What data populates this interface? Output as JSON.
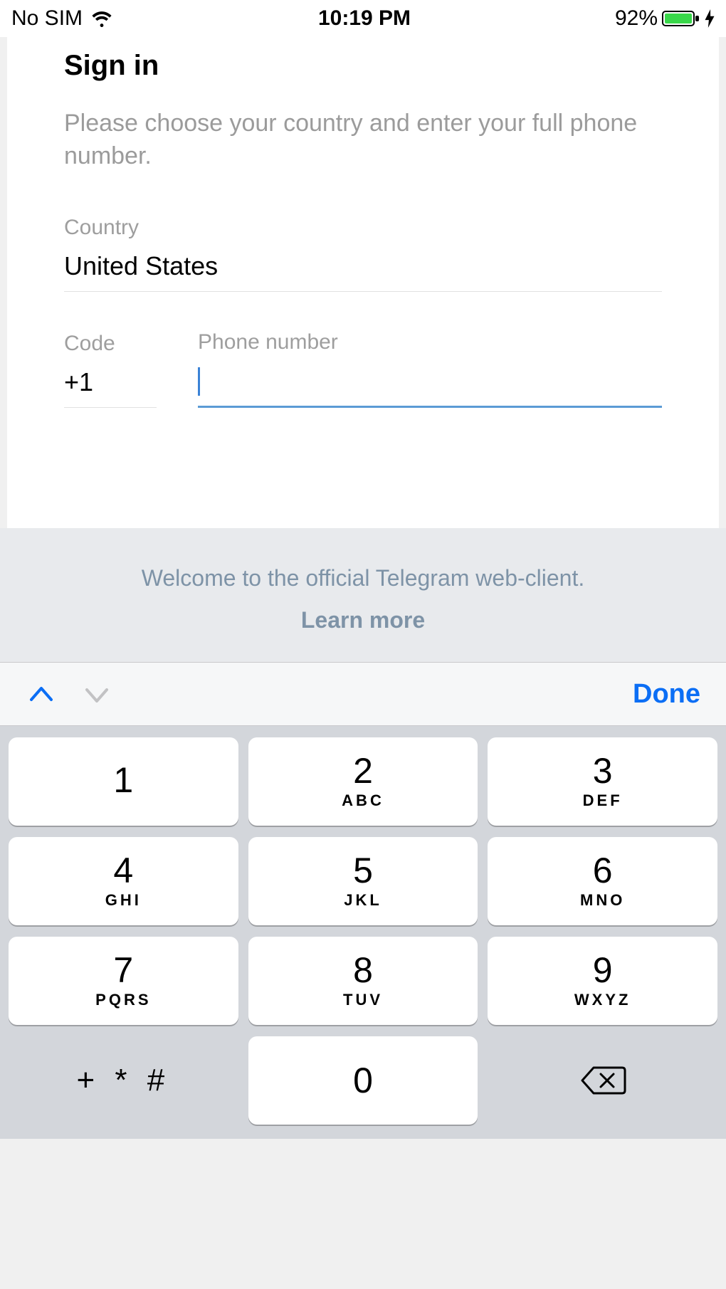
{
  "status": {
    "carrier": "No SIM",
    "time": "10:19 PM",
    "battery_pct": "92%"
  },
  "signin": {
    "title": "Sign in",
    "instructions": "Please choose your country and enter your full phone number.",
    "country_label": "Country",
    "country_value": "United States",
    "code_label": "Code",
    "code_value": "+1",
    "phone_label": "Phone number",
    "phone_value": ""
  },
  "footer": {
    "welcome": "Welcome to the official Telegram web-client.",
    "learn_more": "Learn more"
  },
  "keyboard": {
    "done": "Done",
    "keys": [
      [
        {
          "d": "1",
          "l": ""
        },
        {
          "d": "2",
          "l": "ABC"
        },
        {
          "d": "3",
          "l": "DEF"
        }
      ],
      [
        {
          "d": "4",
          "l": "GHI"
        },
        {
          "d": "5",
          "l": "JKL"
        },
        {
          "d": "6",
          "l": "MNO"
        }
      ],
      [
        {
          "d": "7",
          "l": "PQRS"
        },
        {
          "d": "8",
          "l": "TUV"
        },
        {
          "d": "9",
          "l": "WXYZ"
        }
      ]
    ],
    "symbols": "+ * #",
    "zero": "0"
  }
}
